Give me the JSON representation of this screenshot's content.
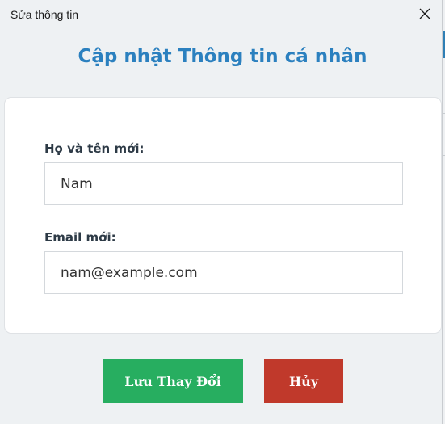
{
  "window": {
    "title": "Sửa thông tin",
    "close_icon": "close-icon"
  },
  "form": {
    "heading": "Cập nhật Thông tin cá nhân",
    "name_label": "Họ và tên mới:",
    "name_value": "Nam",
    "email_label": "Email mới:",
    "email_value": "nam@example.com"
  },
  "actions": {
    "save_label": "Lưu Thay Đổi",
    "cancel_label": "Hủy"
  },
  "colors": {
    "heading": "#2b80bf",
    "save_button": "#27ae60",
    "cancel_button": "#c0392b"
  }
}
